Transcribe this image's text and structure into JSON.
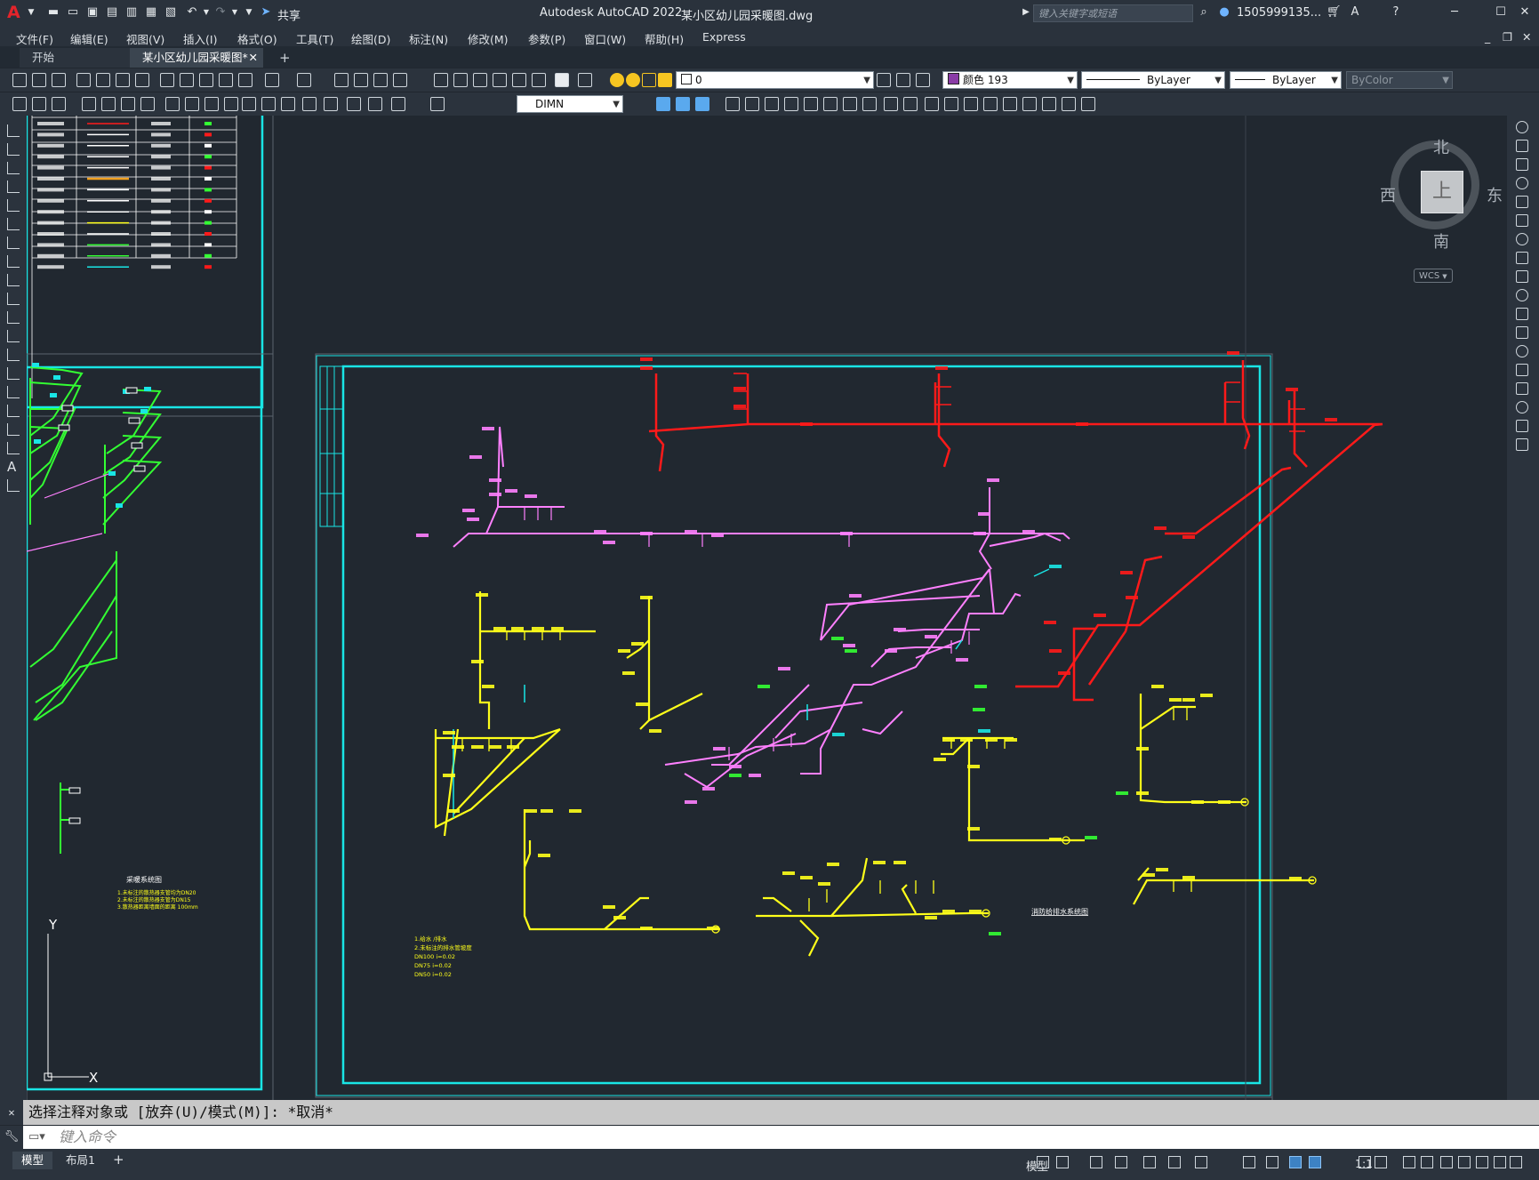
{
  "app": {
    "title": "Autodesk AutoCAD 2022",
    "filename": "某小区幼儿园采暖图.dwg",
    "logo": "A",
    "share_label": "共享",
    "search_placeholder": "键入关键字或短语",
    "user": "1505999135..."
  },
  "menu": [
    "文件(F)",
    "编辑(E)",
    "视图(V)",
    "插入(I)",
    "格式(O)",
    "工具(T)",
    "绘图(D)",
    "标注(N)",
    "修改(M)",
    "参数(P)",
    "窗口(W)",
    "帮助(H)",
    "Express"
  ],
  "tabs": [
    {
      "label": "开始",
      "active": false
    },
    {
      "label": "某小区幼儿园采暖图*",
      "active": true
    }
  ],
  "toolbar": {
    "layer": "0",
    "color": "颜色 193",
    "linetype": "ByLayer",
    "lineweight": "ByLayer",
    "plotstyle": "ByColor",
    "dimstyle": "DIMN"
  },
  "viewcube": {
    "north": "北",
    "south": "南",
    "east": "东",
    "west": "西",
    "face": "上",
    "wcs": "WCS"
  },
  "ucs": {
    "x": "X",
    "y": "Y"
  },
  "drawing": {
    "legend_title": "采暖系统图",
    "legend_notes": [
      "1.未标注的散热器支管均为DN20",
      "2.未标注的散热器支管为DN15",
      "3.散热器距离墙面的距离 100mm"
    ],
    "system_title": "消防给排水系统图",
    "notes": [
      "1.给水 /排水",
      "2.未标注的排水管坡度",
      "DN100 i=0.02",
      "DN75 i=0.02",
      "DN50 i=0.02"
    ],
    "colors": {
      "red": "#ff1a1a",
      "pink": "#ff80ff",
      "yellow": "#ffff1a",
      "green": "#33ff33",
      "cyan": "#1ae6e6",
      "white": "#ffffff"
    }
  },
  "command": {
    "history": "选择注释对象或 [放弃(U)/模式(M)]: *取消*",
    "placeholder": "键入命令"
  },
  "status": {
    "layout_tabs": [
      "模型",
      "布局1"
    ],
    "model_label": "模型",
    "scale": "1:1"
  }
}
